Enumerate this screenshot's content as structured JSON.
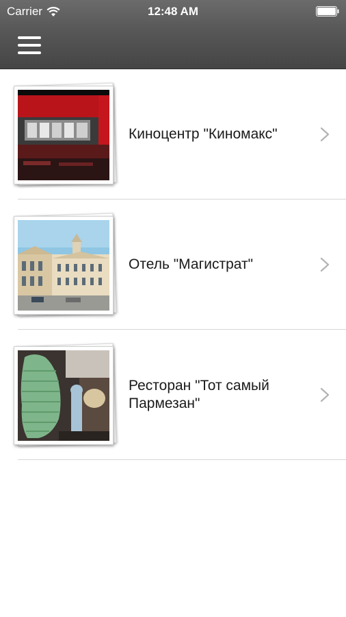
{
  "status_bar": {
    "carrier": "Carrier",
    "time": "12:48 AM",
    "wifi_icon": "wifi-icon",
    "battery_icon": "battery-icon"
  },
  "nav": {
    "menu_icon": "hamburger-menu-icon"
  },
  "colors": {
    "topbar": "#575757",
    "separator": "#d6d6d6",
    "chevron": "#b3b3b3",
    "text": "#1a1a1a"
  },
  "items": [
    {
      "label": "Киноцентр \"Киномакс\"",
      "image": "cinema-building-photo",
      "chevron_icon": "chevron-right-icon"
    },
    {
      "label": "Отель \"Магистрат\"",
      "image": "hotel-building-photo",
      "chevron_icon": "chevron-right-icon"
    },
    {
      "label": "Ресторан \"Тот самый Пармезан\"",
      "image": "restaurant-interior-photo",
      "chevron_icon": "chevron-right-icon"
    }
  ]
}
